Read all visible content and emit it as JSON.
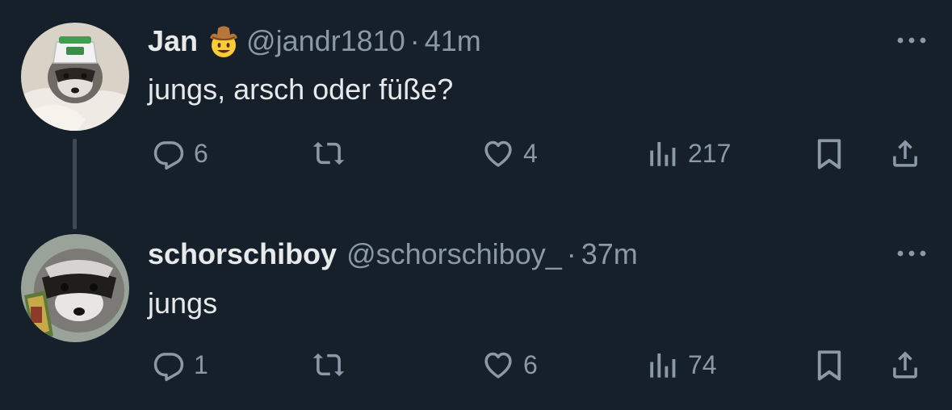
{
  "tweets": [
    {
      "author": {
        "name": "Jan",
        "name_emoji": "cowboy-emoji",
        "handle": "@jandr1810",
        "time_separator": "·",
        "time": "41m"
      },
      "text": "jungs, arsch oder füße?",
      "stats": {
        "replies": "6",
        "retweets": "",
        "likes": "4",
        "views": "217"
      },
      "more_icon": "more-horizontal-icon"
    },
    {
      "author": {
        "name": "schorschiboy",
        "handle": "@schorschiboy_",
        "time_separator": "·",
        "time": "37m"
      },
      "text": "jungs",
      "stats": {
        "replies": "1",
        "retweets": "",
        "likes": "6",
        "views": "74"
      },
      "more_icon": "more-horizontal-icon"
    }
  ],
  "icons": {
    "reply": "reply-icon",
    "retweet": "retweet-icon",
    "like": "heart-icon",
    "views": "views-bar-chart-icon",
    "bookmark": "bookmark-icon",
    "share": "share-icon"
  },
  "colors": {
    "background": "#15202b",
    "text_primary": "#e7e9ea",
    "text_secondary": "#8b98a5",
    "thread_line": "#3d4955"
  }
}
